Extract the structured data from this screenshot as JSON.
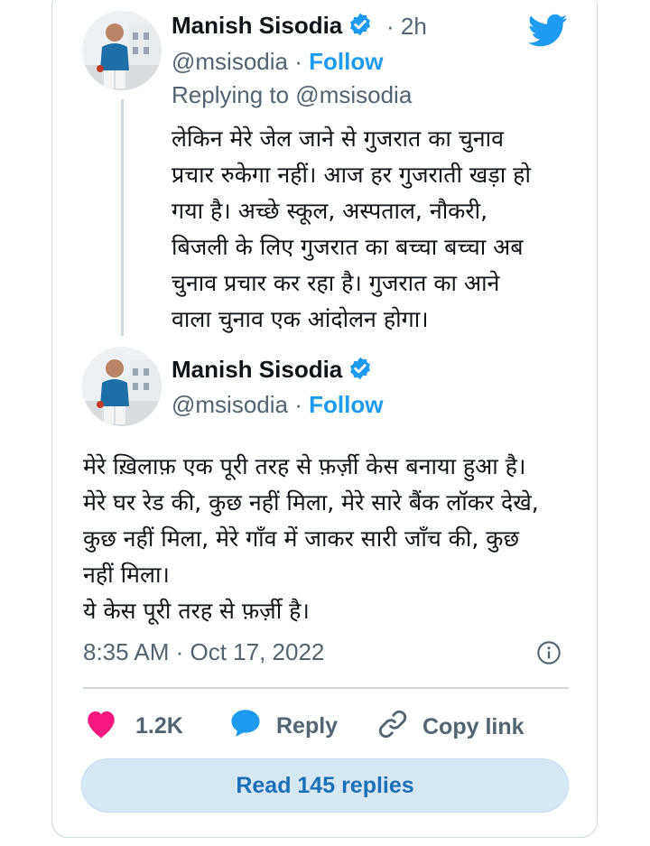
{
  "colors": {
    "accent": "#1d9bf0",
    "like": "#f91880",
    "text": "#0f1419",
    "muted": "#536471"
  },
  "tweet1": {
    "name": "Manish Sisodia",
    "time": "2h",
    "handle": "@msisodia",
    "separator": "·",
    "follow": "Follow",
    "replying_to": "Replying to @msisodia",
    "text": "लेकिन मेरे जेल जाने से गुजरात का चुनाव\nप्रचार रुकेगा नहीं। आज हर गुजराती खड़ा हो\nगया है। अच्छे स्कूल, अस्पताल, नौकरी,\nबिजली के लिए गुजरात का बच्चा बच्चा अब\nचुनाव प्रचार कर रहा है। गुजरात का आने\nवाला चुनाव एक आंदोलन होगा।"
  },
  "tweet2": {
    "name": "Manish Sisodia",
    "handle": "@msisodia",
    "separator": "·",
    "follow": "Follow",
    "text": "मेरे ख़िलाफ़ एक पूरी तरह से फ़र्ज़ी केस बनाया हुआ है।\nमेरे घर रेड की, कुछ नहीं मिला, मेरे सारे बैंक लॉकर देखे,\nकुछ नहीं मिला, मेरे गाँव में जाकर  सारी जाँच की, कुछ\nनहीं मिला।\nये केस पूरी तरह से फ़र्ज़ी है।",
    "timestamp": "8:35 AM · Oct 17, 2022"
  },
  "actions": {
    "likes": "1.2K",
    "reply": "Reply",
    "copy_link": "Copy link"
  },
  "read_replies": "Read 145 replies",
  "icons": [
    "twitter-bird-icon",
    "verified-badge-icon",
    "info-icon",
    "heart-icon",
    "reply-bubble-icon",
    "link-icon"
  ]
}
